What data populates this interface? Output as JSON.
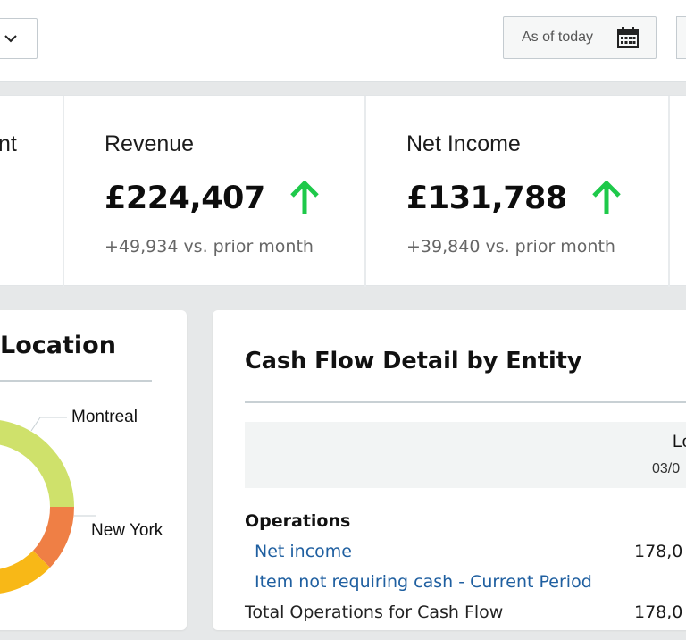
{
  "toolbar": {
    "date_label": "As of today",
    "icons": {
      "dropdown": "chevron-down-icon",
      "date": "calendar-icon"
    }
  },
  "kpis": [
    {
      "title": "nt"
    },
    {
      "title": "Revenue",
      "value": "£224,407",
      "delta": "+49,934 vs. prior month",
      "trend": "up"
    },
    {
      "title": "Net Income",
      "value": "£131,788",
      "delta": "+39,840 vs. prior month",
      "trend": "up"
    }
  ],
  "colors": {
    "up_arrow": "#1ec94a",
    "link": "#1f5fa0",
    "donut": [
      "#cfe16b",
      "#ef7f45",
      "#f8b817"
    ]
  },
  "location_card": {
    "title": "Location",
    "labels": {
      "montreal": "Montreal",
      "new_york": "New York"
    }
  },
  "cash_flow": {
    "title": "Cash Flow Detail by Entity",
    "column_header": {
      "line1": "Lo",
      "line2": "03/0"
    },
    "rows": [
      {
        "label": "Operations",
        "type": "section",
        "value": ""
      },
      {
        "label": "Net income",
        "type": "link",
        "value": "178,0"
      },
      {
        "label": "Item not requiring cash - Current Period",
        "type": "link",
        "value": ""
      },
      {
        "label": "Total Operations for Cash Flow",
        "type": "total",
        "value": "178,0"
      }
    ]
  }
}
